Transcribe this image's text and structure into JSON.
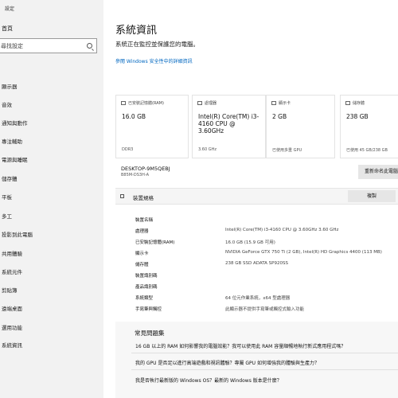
{
  "sidebar": {
    "app_title": "設定",
    "home": "首頁",
    "search_placeholder": "尋找設定",
    "items": [
      "顯示器",
      "音效",
      "通知與動作",
      "專注輔助",
      "電源與睡眠",
      "儲存體",
      "平板",
      "多工",
      "投影到此電腦",
      "共用體驗",
      "系統元件",
      "剪貼簿",
      "遠端桌面",
      "選用功能",
      "系統資訊"
    ]
  },
  "main": {
    "title": "系統資訊",
    "subtitle": "系統正在監控並保護您的電腦。",
    "security_link": "參閱 Windows 安全性中的詳細資訊",
    "cards": [
      {
        "icon": "memory-icon",
        "head": "已安裝記憶體(RAM)",
        "value": "16.0 GB",
        "foot": "DDR3"
      },
      {
        "icon": "processor-icon",
        "head": "處理器",
        "value": "Intel(R) Core(TM) i3-4160 CPU @ 3.60GHz",
        "foot": "3.60 GHz"
      },
      {
        "icon": "display-icon",
        "head": "顯示卡",
        "value": "2 GB",
        "foot": "已使用多重 GPU"
      },
      {
        "icon": "storage-icon",
        "head": "儲存體",
        "value": "238 GB",
        "foot": "已使用 45 GB/238 GB"
      }
    ],
    "device": {
      "name": "DESKTOP-9M5QEBJ",
      "model": "B85M-DS3H-A",
      "rename_button": "重新命名此電腦"
    },
    "specs": {
      "title": "裝置規格",
      "copy_button": "複製",
      "rows": [
        {
          "label": "裝置名稱",
          "value": ""
        },
        {
          "label": "處理器",
          "value": "Intel(R) Core(TM) i3-4160 CPU @ 3.60GHz   3.60 GHz"
        },
        {
          "label": "已安裝記憶體(RAM)",
          "value": "16.0 GB (15.9 GB 可用)"
        },
        {
          "label": "顯示卡",
          "value": "NVIDIA GeForce GTX 750 Ti (2 GB), Intel(R) HD Graphics 4400 (113 MB)"
        },
        {
          "label": "儲存體",
          "value": "238 GB SSD ADATA SP920SS"
        },
        {
          "label": "裝置識別碼",
          "value": ""
        },
        {
          "label": "產品識別碼",
          "value": ""
        },
        {
          "label": "系統類型",
          "value": "64 位元作業系統，x64 型處理器"
        },
        {
          "label": "手寫筆與觸控",
          "value": "此顯示器不提供手寫筆或觸控式輸入功能"
        }
      ]
    },
    "faq": {
      "title": "常見問題集",
      "questions": [
        "16 GB 以上的 RAM 如何影響我的電腦效能？我可以使用此 RAM 容量順暢地執行新式應用程式嗎？",
        "我的 GPU 是否足以進行高端遊戲和視訊體驗？專屬 GPU 如何增強我的體驗與生產力？",
        "我是否執行最新版的 Windows OS？最新的 Windows 版本是什麼？"
      ]
    }
  }
}
